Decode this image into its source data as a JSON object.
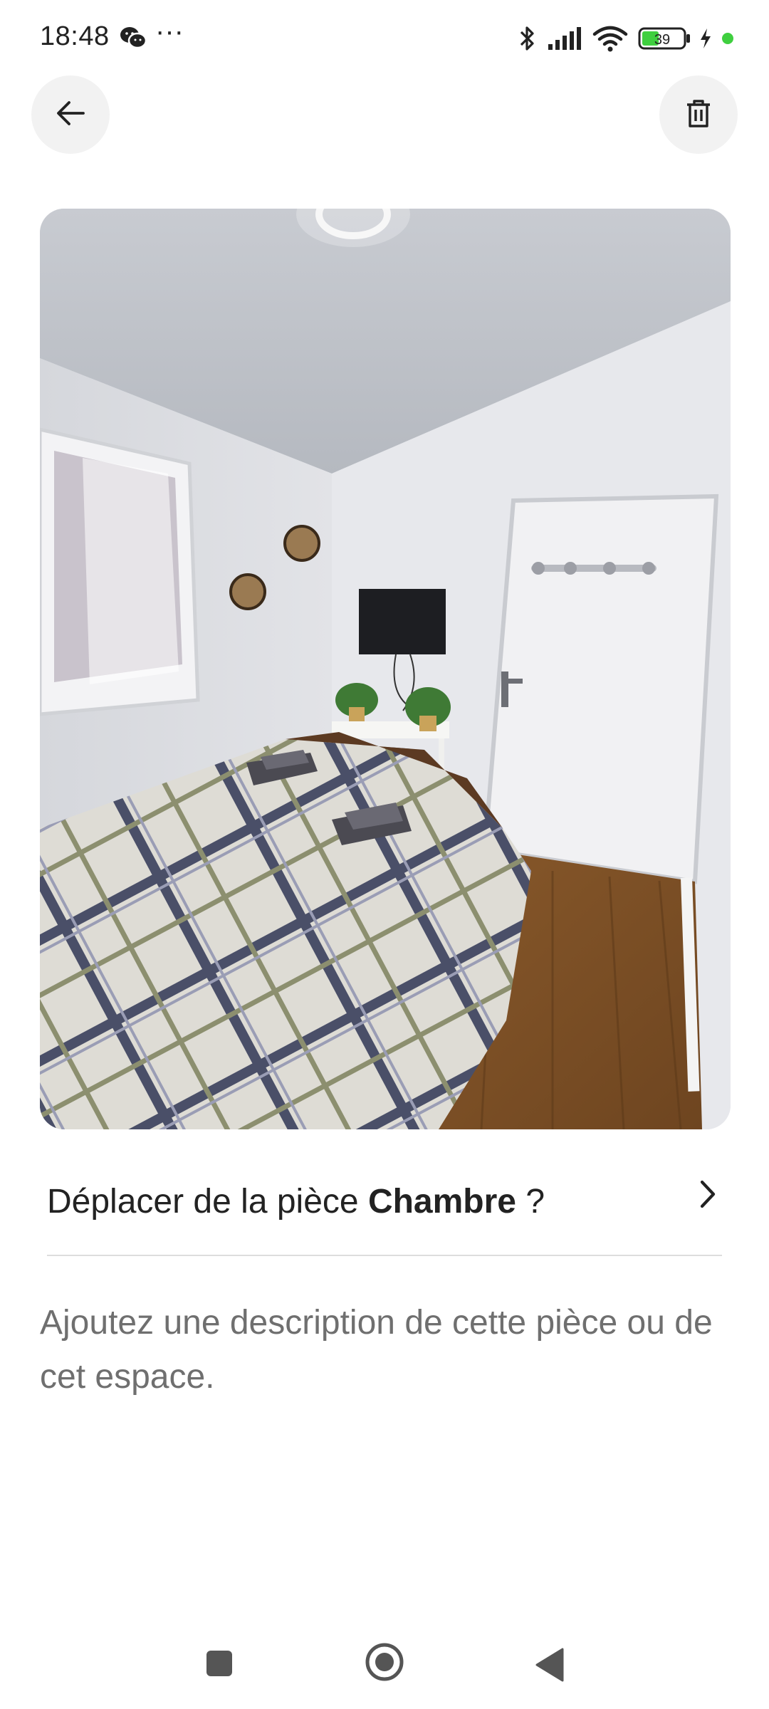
{
  "status_bar": {
    "time": "18:48",
    "more": "···",
    "battery": "39",
    "icons": [
      "wechat-icon",
      "bluetooth-icon",
      "signal-icon",
      "wifi-icon",
      "battery-icon",
      "charging-icon"
    ]
  },
  "header": {
    "back_icon": "arrow-left-icon",
    "delete_icon": "trash-icon"
  },
  "photo": {
    "subject": "room-photo"
  },
  "move_row": {
    "prefix": "Déplacer de la pièce ",
    "room": "Chambre",
    "suffix": " ?",
    "chevron_icon": "chevron-right-icon"
  },
  "description": {
    "placeholder": "Ajoutez une description de cette pièce ou de cet espace."
  },
  "nav_bar": {
    "icons": [
      "recents-square-icon",
      "home-circle-icon",
      "back-triangle-icon"
    ]
  },
  "colors": {
    "text": "#222222",
    "muted": "#6f6f6f",
    "divider": "#dddddd",
    "button_bg": "#f2f2f2",
    "battery_green": "#3fcf3f"
  }
}
